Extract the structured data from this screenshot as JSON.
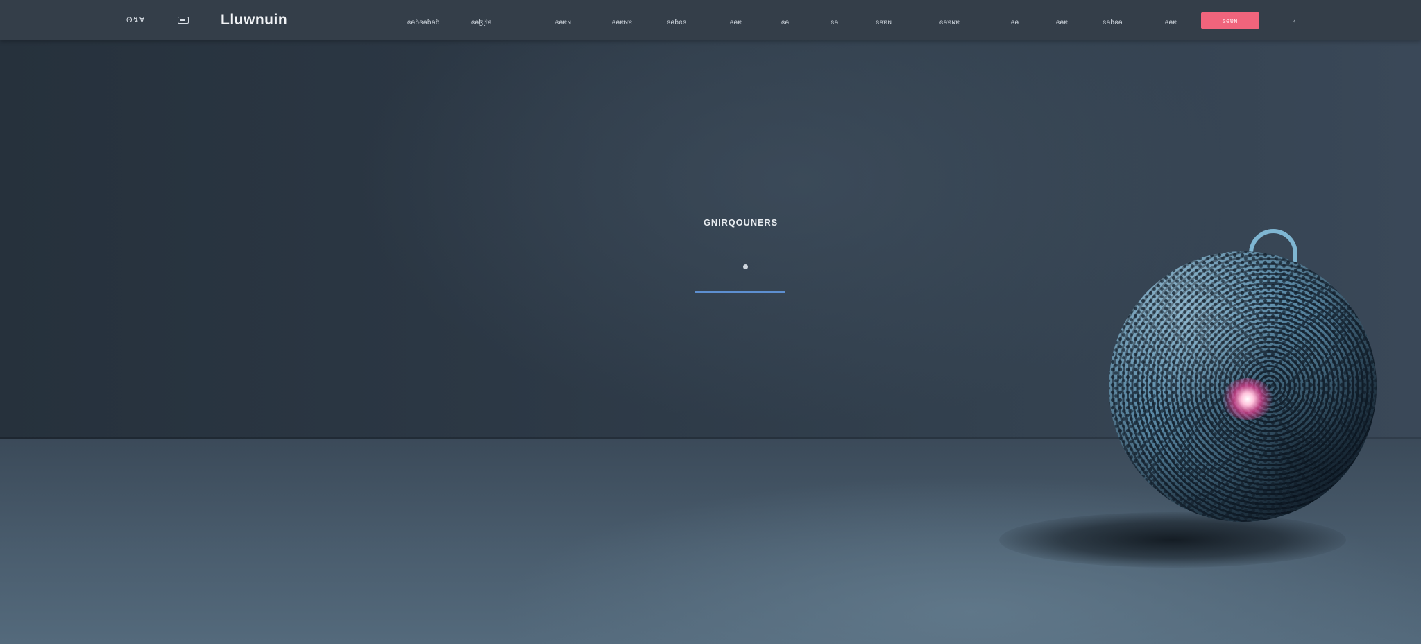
{
  "navbar": {
    "left_link": "ʘ↯Ɐ",
    "brand": "Lluwnuin",
    "links": [
      "ɞɵɓɞɵɓɵɓ",
      "ɞɵɮɭɬɐ",
      "ɞɵɐɴ",
      "ɞɵɐɴɐ",
      "ɞɵɓɞɞ",
      "ɞɵɐ",
      "ɞɵ",
      "ɞɵ",
      "ɞɵɐɴ",
      "ɞɵɐɴɐ",
      "ɞɵ",
      "ɞɵɐ",
      "ɞɵɓɞɵ",
      "ɞɵɐ"
    ],
    "cta_label": "ɞɵɐɴ",
    "close_label": "‹"
  },
  "hero": {
    "title": "GNIRQOUNERS"
  },
  "colors": {
    "accent": "#f0647c",
    "underline": "#5d8fd0",
    "navbar_bg": "#343e49",
    "sphere": "#4d7a96",
    "glow": "#e0468f"
  },
  "icons": {
    "menu": "menu-icon",
    "close": "chevron-left-icon"
  }
}
